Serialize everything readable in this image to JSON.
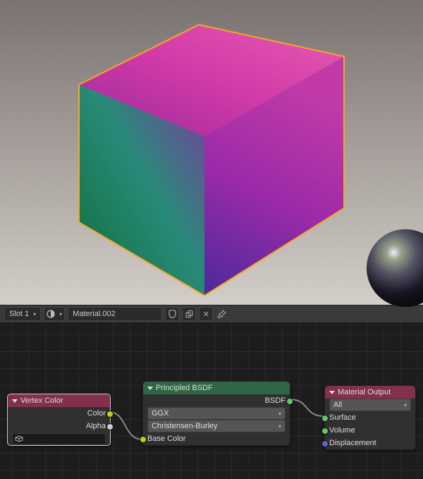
{
  "header": {
    "slot_label": "Slot 1",
    "material_name": "Material.002"
  },
  "viewport": {
    "object": "Cube",
    "selected": true,
    "outline_color": "#f5a623"
  },
  "nodes": {
    "vertex_color": {
      "title": "Vertex Color",
      "out_color": "Color",
      "out_alpha": "Alpha",
      "name_field_icon": "mesh-data-icon"
    },
    "principled": {
      "title": "Principled BSDF",
      "out_bsdf": "BSDF",
      "distribution": "GGX",
      "sss_method": "Christensen-Burley",
      "in_base_color": "Base Color"
    },
    "output": {
      "title": "Material Output",
      "target": "All",
      "in_surface": "Surface",
      "in_volume": "Volume",
      "in_displacement": "Displacement"
    }
  }
}
